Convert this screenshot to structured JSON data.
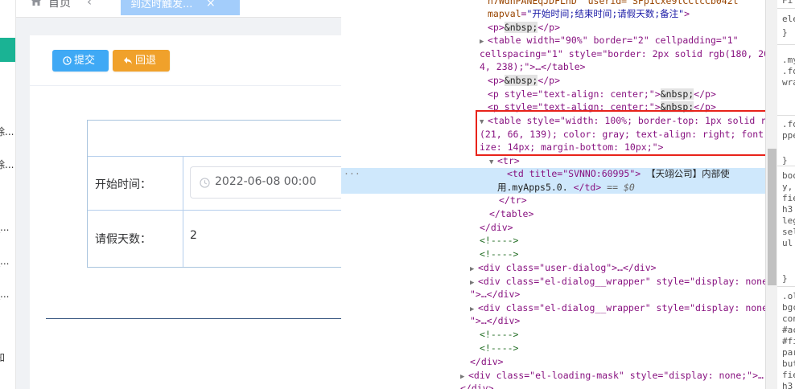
{
  "sidebar": {
    "items": [
      {
        "label": "除..."
      },
      {
        "label": "除..."
      },
      {
        "label": "_..."
      },
      {
        "label": "_..."
      },
      {
        "label": "_..."
      },
      {
        "label": "知"
      }
    ]
  },
  "tabs": {
    "home": "首页",
    "active": "到达时触发...",
    "close": "×",
    "back": "‹"
  },
  "toolbar": {
    "submit_label": "提交",
    "back_label": "回退"
  },
  "form": {
    "start_time_label": "开始时间：",
    "start_time_value": "2022-06-08 00:00",
    "leave_days_label": "请假天数：",
    "leave_days_value": "2"
  },
  "devtools": {
    "l1_attrs": "n7WdnPANEqJDFLhD\" userid=\"SFp1Cxe9tCCtcCb042t",
    "l2_an": "mapval",
    "l2_av": "\"开始时间;结束时间;请假天数;备注\"",
    "nbsp": "&nbsp;",
    "table1_a": "<table width=\"90%\" border=\"2\" cellpadding=\"1\"",
    "table1_b": "cellspacing=\"1\" style=\"border: 2px solid rgb(180, 20",
    "table1_c": "4, 238);\">…</table>",
    "p_center": "<p style=\"text-align: center;\">",
    "p_close": "</p>",
    "sel_table_a": "<table style=\"width: 100%; border-top: 1px solid rgb",
    "sel_table_b": "(21, 66, 139); color: gray; text-align: right; font-s",
    "sel_table_c": "ize: 14px; margin-bottom: 10px;\">",
    "tr_open": "<tr>",
    "td_open": "<td title=\"SVNNO:60995\">",
    "td_text_a": "【天翊公司】内部使",
    "td_text_b": "用.myApps5.0.",
    "td_close": "</td>",
    "eq0": "== $0",
    "tr_close": "</tr>",
    "table_close": "</table>",
    "div_close": "</div>",
    "comment": "<!---->",
    "user_dialog": "<div class=\"user-dialog\">…</div>",
    "dialog_wrapper_a": "<div class=\"el-dialog__wrapper\" style=\"display: none;",
    "dialog_wrapper_b": "\">…</div>",
    "loading_mask": "<div class=\"el-loading-mask\" style=\"display: none;\">…",
    "last_close": "</div>",
    "dots": "···"
  },
  "styles_pane": {
    "lines": [
      "Fi",
      "ele",
      "}",
      ".my",
      ".fo",
      "wra",
      ".fo",
      "ppe",
      "}",
      "boo",
      "y,",
      "fie",
      "h3",
      "leg",
      "sel",
      "ul",
      "}",
      ".ol",
      "bgc",
      "con",
      "#ac",
      "#fi",
      "par",
      "but",
      "fie",
      "h3"
    ]
  },
  "colors": {
    "submit": "#3fa9f5",
    "back": "#f0a12b",
    "highlight": "#e8231a",
    "selected_row": "#cfe8fc",
    "sidebar_accent": "#1ab394"
  }
}
